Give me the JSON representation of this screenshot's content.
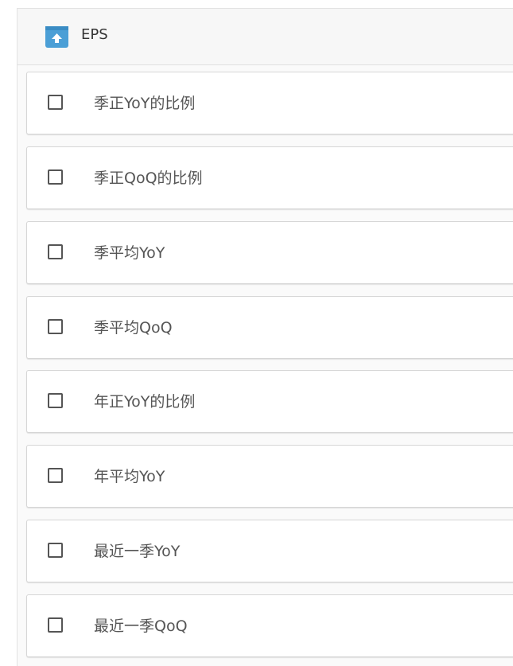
{
  "panel": {
    "title": "EPS",
    "icon": "collapse-up-icon",
    "accent_color": "#4b9fd6"
  },
  "options": [
    {
      "label": "季正YoY的比例",
      "checked": false
    },
    {
      "label": "季正QoQ的比例",
      "checked": false
    },
    {
      "label": "季平均YoY",
      "checked": false
    },
    {
      "label": "季平均QoQ",
      "checked": false
    },
    {
      "label": "年正YoY的比例",
      "checked": false
    },
    {
      "label": "年平均YoY",
      "checked": false
    },
    {
      "label": "最近一季YoY",
      "checked": false
    },
    {
      "label": "最近一季QoQ",
      "checked": false
    }
  ]
}
